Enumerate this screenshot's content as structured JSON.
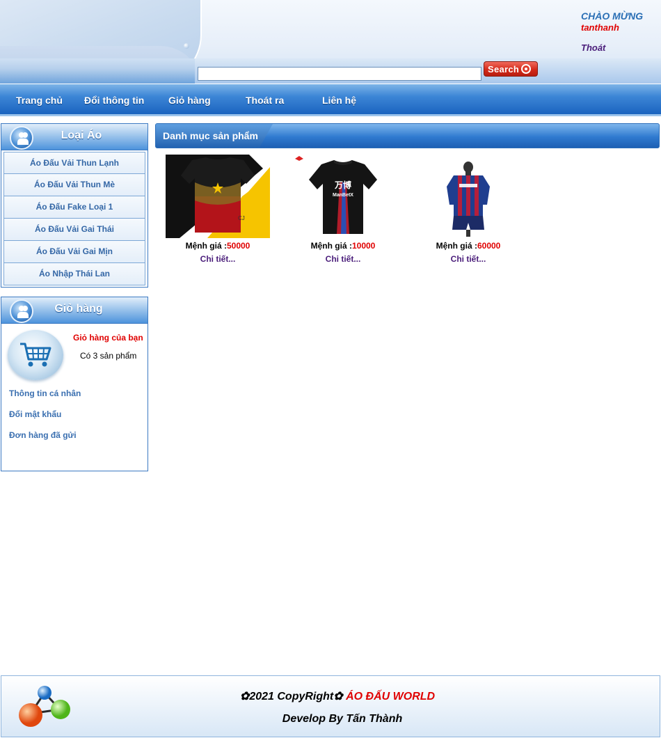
{
  "header": {
    "welcome": "CHÀO MỪNG",
    "username": "tanthanh",
    "logout": "Thoát"
  },
  "search": {
    "value": "",
    "placeholder": "",
    "button_label": "Search"
  },
  "nav": {
    "items": [
      {
        "label": "Trang chủ"
      },
      {
        "label": "Đổi thông tin"
      },
      {
        "label": "Giỏ hàng"
      },
      {
        "label": "Thoát ra"
      },
      {
        "label": "Liên hệ"
      }
    ]
  },
  "sidebar": {
    "category": {
      "title": "Loại Áo",
      "items": [
        "Áo Đấu Vải Thun Lạnh",
        "Áo Đấu Vải Thun Mè",
        "Áo Đấu Fake Loại 1",
        "Áo Đấu Vải Gai Thái",
        "Áo Đấu Vải Gai Mịn",
        "Áo Nhập Thái Lan"
      ]
    },
    "cart": {
      "title": "Giỏ hàng",
      "cart_title": "Giỏ hàng của bạn",
      "count_text": "Có 3 sản phẩm",
      "links": [
        "Thông tin cá nhân",
        "Đổi mật khẩu",
        "Đơn hàng đã gửi"
      ]
    }
  },
  "content": {
    "title": "Danh mục sản phẩm",
    "products": [
      {
        "price_label": "Mệnh giá :",
        "price": "50000",
        "detail": "Chi tiết...",
        "image": "black-gold-vietnam-jersey"
      },
      {
        "price_label": "Mệnh giá :",
        "price": "10000",
        "detail": "Chi tiết...",
        "image": "black-striped-jersey"
      },
      {
        "price_label": "Mệnh giá :",
        "price": "60000",
        "detail": "Chi tiết...",
        "image": "red-blue-striped-kit"
      }
    ]
  },
  "footer": {
    "copyright_prefix": "✿2021 CopyRight✿ ",
    "brand": "ÁO ĐẤU WORLD",
    "developer": "Develop By Tấn Thành"
  },
  "colors": {
    "accent_blue": "#1a63bf",
    "price_red": "#e00000",
    "link_purple": "#4a1d7a"
  }
}
